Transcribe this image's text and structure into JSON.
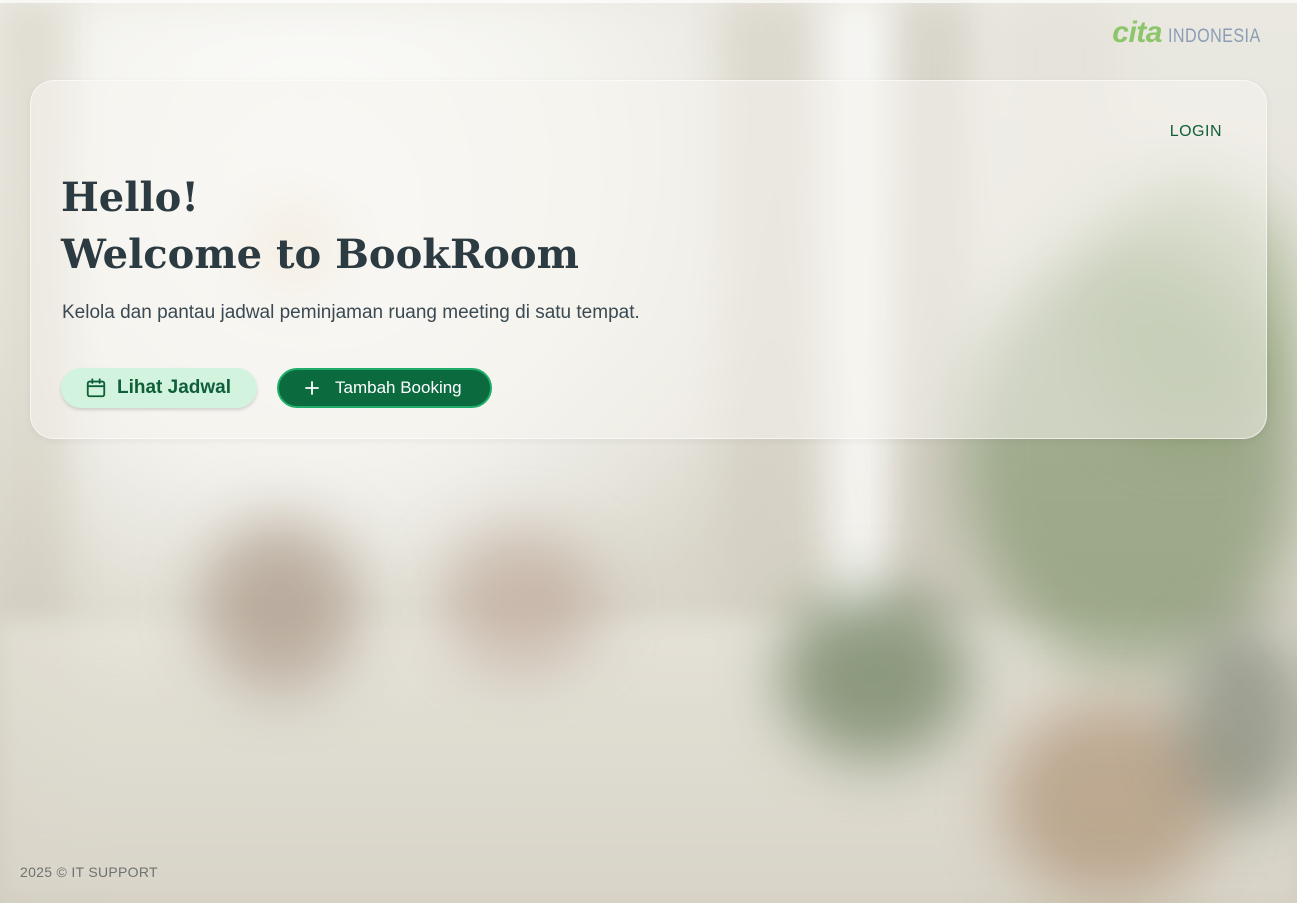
{
  "brand": {
    "name_part1": "cita",
    "name_part2": "INDONESIA"
  },
  "nav": {
    "login_label": "LOGIN"
  },
  "hero": {
    "title_line1": "Hello!",
    "title_line2": "Welcome to BookRoom",
    "subtitle": "Kelola dan pantau jadwal peminjaman ruang meeting di satu tempat."
  },
  "actions": {
    "view_schedule_label": "Lihat Jadwal",
    "view_schedule_icon": "calendar-icon",
    "add_booking_label": "Tambah Booking",
    "add_booking_icon": "plus-icon"
  },
  "footer": {
    "text": "2025 © IT SUPPORT"
  },
  "colors": {
    "primary": "#0b6b3f",
    "primary_light": "#d2f3dd",
    "brand_green": "#8cc56a",
    "brand_gray": "#8a9db5",
    "heading": "#2c3a42"
  }
}
